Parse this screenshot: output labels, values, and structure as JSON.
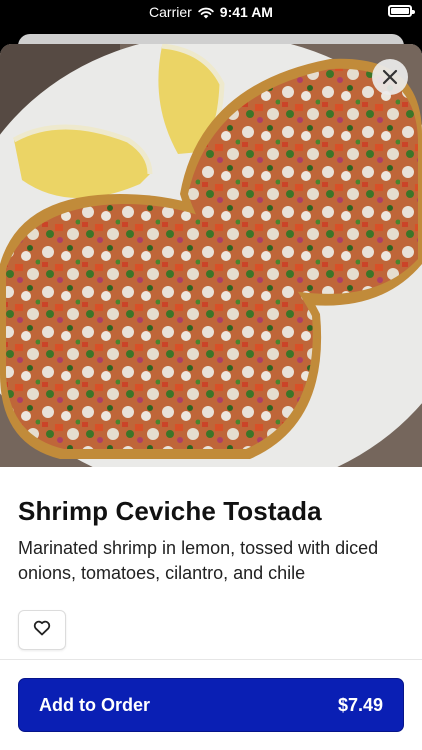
{
  "status_bar": {
    "carrier": "Carrier",
    "time": "9:41 AM",
    "icons": [
      "wifi-icon",
      "battery-icon"
    ]
  },
  "item": {
    "name": "Shrimp Ceviche Tostada",
    "description": "Marinated shrimp in lemon, tossed with diced onions, tomatoes, cilantro, and chile",
    "price": "$7.49"
  },
  "actions": {
    "close_icon": "close-icon",
    "favorite_icon": "heart-icon",
    "add_to_order_label": "Add to Order"
  },
  "colors": {
    "primary_button": "#0a1fb4",
    "text": "#111111"
  }
}
